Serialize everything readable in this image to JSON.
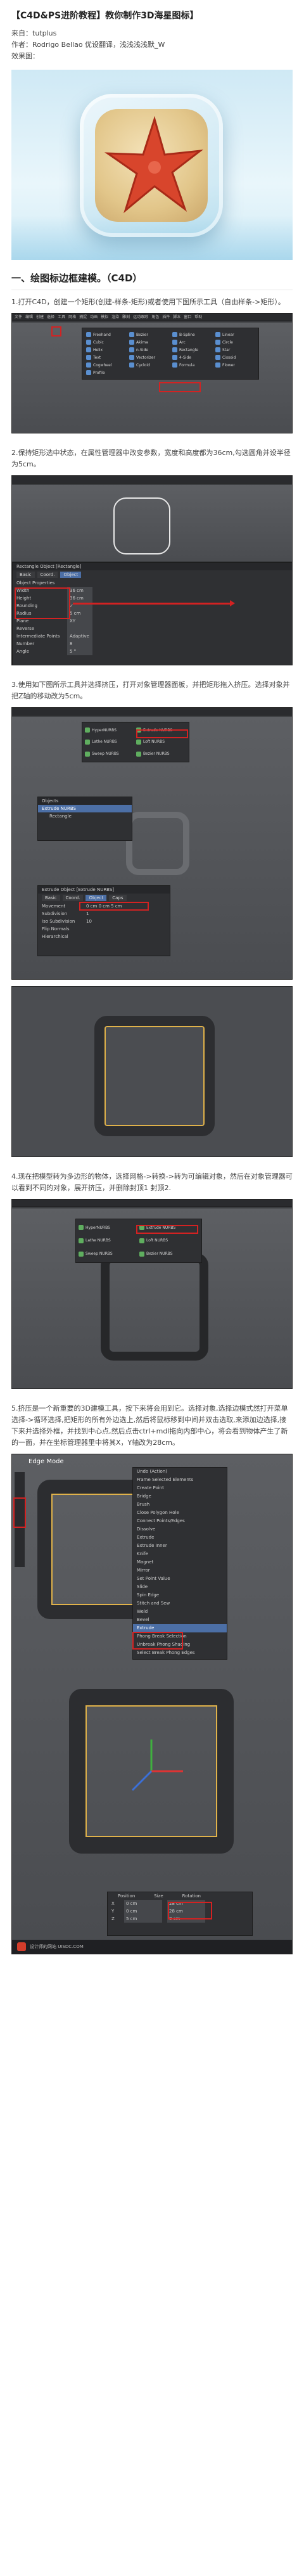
{
  "header": {
    "title": "【C4D&PS进阶教程】教你制作3D海星图标】",
    "source": "来自：tutplus",
    "author": "作者：Rodrigo Bellao   优设翻译，浅浅浅浅默_W",
    "preview": "效果图："
  },
  "section1": {
    "title": "一、绘图标边框建模。（C4D）",
    "steps": [
      "1.打开C4D，创建一个矩形(创建-样条-矩形)或者使用下图所示工具（自由样条->矩形）。",
      "2.保持矩形选中状态，在属性管理器中改变参数，宽度和高度都为36cm,勾选圆角并设半径为5cm。",
      "3.使用如下图所示工具并选择挤压，打开对象管理器面板，并把矩形拖入挤压。选择对象并把Z轴的移动改为5cm。",
      "4.现在把模型转为多边形的物体，选择网格->转换->转为可编辑对象，然后在对象管理器可以看到不同的对象，展开挤压，并删除封顶1 封顶2.",
      "5.挤压是一个新重要的3D建模工具，按下来将会用到它。选择对象,选择边模式然打开菜单选择->循环选择,把矩形的所有外边选上,然后将鼠标移到中间并双击选取,来添加边选择,接下来并选择外框，并找到中心点,然后点击ctrl+mdl拖向内部中心，将会看到物体产生了新的一面，并在坐标管理器里中将其X，Y轴改为28cm。"
    ]
  },
  "shot1": {
    "menu": [
      "文件",
      "编辑",
      "创建",
      "选择",
      "工具",
      "网格",
      "捕捉",
      "动画",
      "模拟",
      "渲染",
      "雕刻",
      "运动跟踪",
      "角色",
      "插件",
      "脚本",
      "窗口",
      "帮助"
    ],
    "tools": [
      "Freehand",
      "Bezier",
      "B-Spline",
      "Linear",
      "Cubic",
      "Akima",
      "Arc",
      "Circle",
      "Helix",
      "n-Side",
      "Rectangle",
      "Star",
      "Text",
      "Vectorizer",
      "4-Side",
      "Cissoid",
      "Cogwheel",
      "Cycloid",
      "Formula",
      "Flower",
      "Profile"
    ]
  },
  "shot2": {
    "panel_title": "Rectangle Object [Rectangle]",
    "tabs": [
      "Basic",
      "Coord.",
      "Object"
    ],
    "props_title": "Object Properties",
    "rows": [
      {
        "label": "Width",
        "value": "36 cm"
      },
      {
        "label": "Height",
        "value": "36 cm"
      },
      {
        "label": "Rounding",
        "value": "✓"
      },
      {
        "label": "Radius",
        "value": "5 cm"
      },
      {
        "label": "Plane",
        "value": "XY"
      },
      {
        "label": "Reverse",
        "value": ""
      },
      {
        "label": "Intermediate Points",
        "value": "Adaptive"
      },
      {
        "label": "Number",
        "value": "8"
      },
      {
        "label": "Angle",
        "value": "5 °"
      }
    ]
  },
  "shot3": {
    "generators": [
      "HyperNURBS",
      "Extrude NURBS",
      "Lathe NURBS",
      "Loft NURBS",
      "Sweep NURBS",
      "Bezier NURBS"
    ],
    "objects": [
      "Extrude NURBS",
      "Rectangle"
    ],
    "attr_title": "Extrude Object [Extrude NURBS]",
    "attr_tabs": [
      "Basic",
      "Coord.",
      "Object",
      "Caps"
    ],
    "attr_rows": [
      {
        "label": "Movement",
        "value": "0 cm   0 cm   5 cm"
      },
      {
        "label": "Subdivision",
        "value": "1"
      },
      {
        "label": "Iso Subdivision",
        "value": "10"
      },
      {
        "label": "Flip Normals",
        "value": ""
      },
      {
        "label": "Hierarchical",
        "value": ""
      }
    ]
  },
  "shot5": {
    "mode_label": "Edge Mode",
    "menu_items": [
      "Undo (Action)",
      "Frame Selected Elements",
      "Create Point",
      "Bridge",
      "Brush",
      "Close Polygon Hole",
      "Connect Points/Edges",
      "Dissolve",
      "Extrude",
      "Extrude Inner",
      "Knife",
      "Magnet",
      "Mirror",
      "Set Point Value",
      "Slide",
      "Spin Edge",
      "Stitch and Sew",
      "Weld",
      "Bevel",
      "Extrude",
      "Phong Break Selection",
      "Unbreak Phong Shading",
      "Select Break Phong Edges"
    ],
    "coords": [
      {
        "label": "X",
        "pos": "0 cm",
        "size": "28 cm"
      },
      {
        "label": "Y",
        "pos": "0 cm",
        "size": "28 cm"
      },
      {
        "label": "Z",
        "pos": "5 cm",
        "size": "0 cm"
      }
    ],
    "coord_headers": [
      "Position",
      "Size",
      "Rotation"
    ]
  },
  "footer": {
    "site": "设计师的网站 UISDC.COM"
  },
  "colors": {
    "highlight": "#d32222",
    "ui_dark": "#2f3033",
    "select_blue": "#4c6fa6"
  }
}
